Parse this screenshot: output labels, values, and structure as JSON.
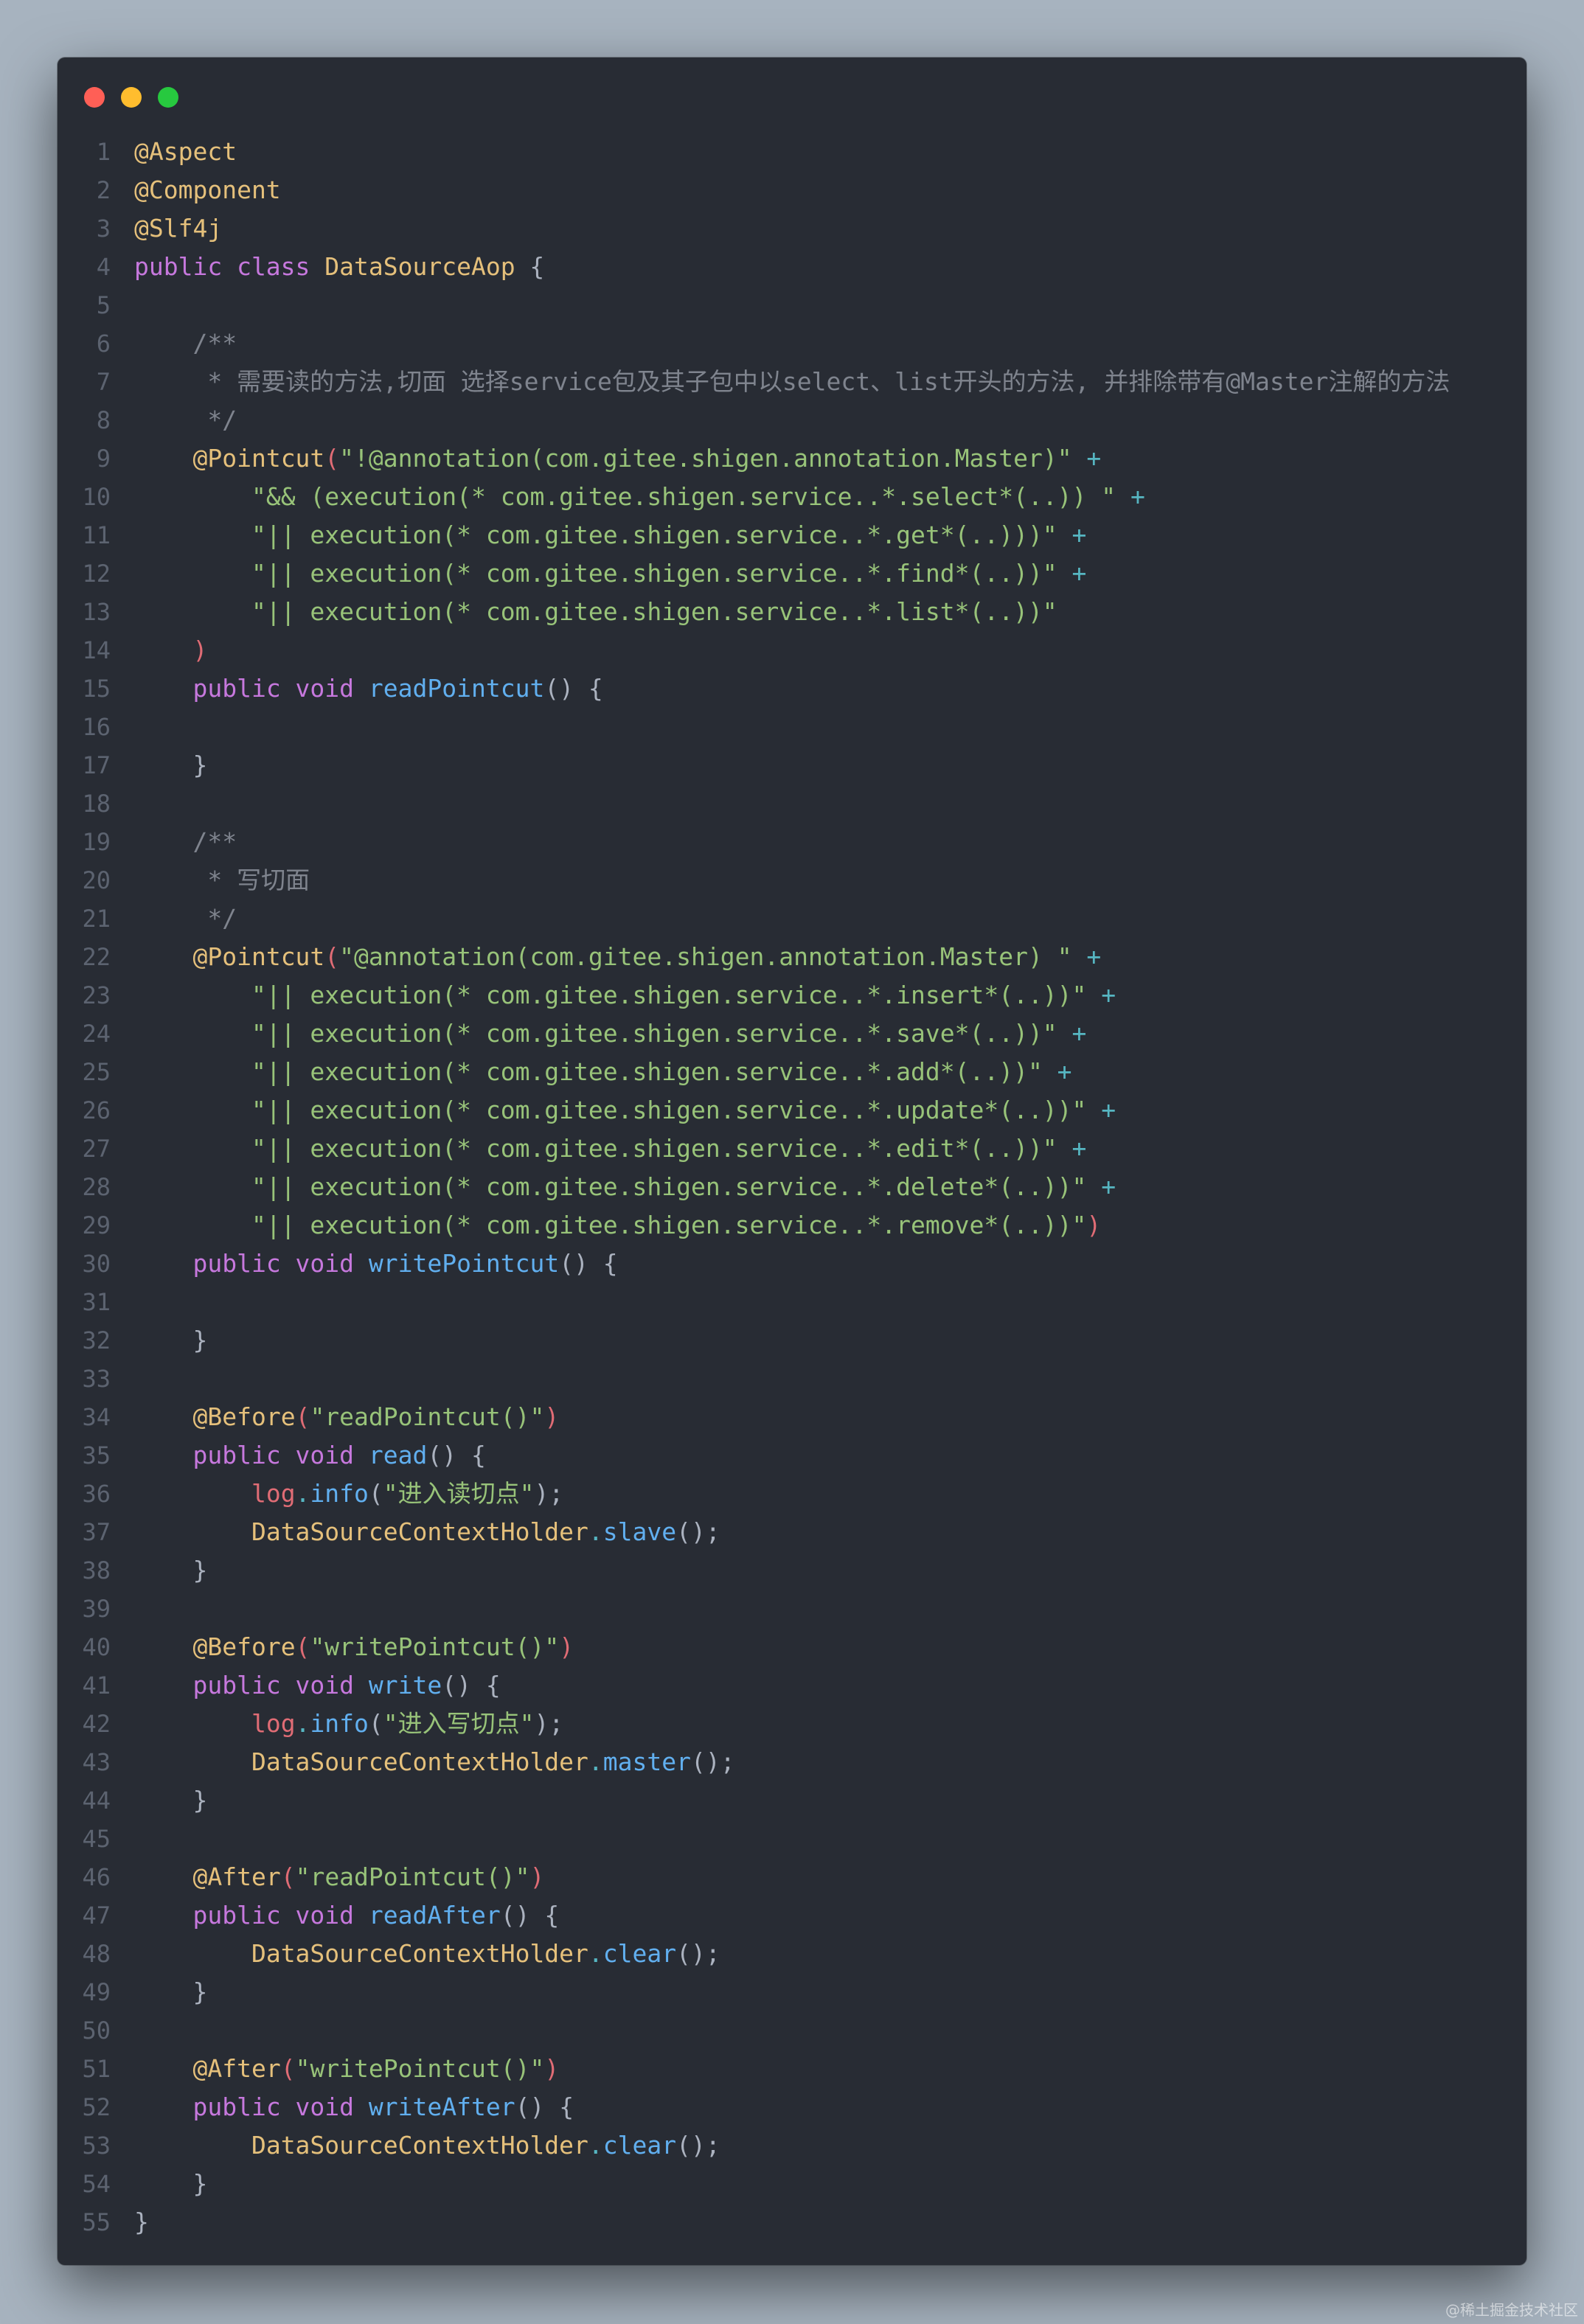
{
  "window": {
    "traffic_lights": [
      {
        "name": "close",
        "color": "#ff5f56"
      },
      {
        "name": "minimize",
        "color": "#ffbd2e"
      },
      {
        "name": "maximize",
        "color": "#27c93f"
      }
    ]
  },
  "theme": {
    "background": "#282c34",
    "page_background": "#a7b3bf",
    "line_number": "#5c6370",
    "keyword": "#c678dd",
    "annotation": "#e5c07b",
    "class_name": "#e5c07b",
    "function": "#61afef",
    "string": "#98c379",
    "operator": "#56b6c2",
    "comment": "#7f848e",
    "variable": "#e06c75"
  },
  "code_lines": [
    [
      [
        "ann",
        "@Aspect"
      ]
    ],
    [
      [
        "ann",
        "@Component"
      ]
    ],
    [
      [
        "ann",
        "@Slf4j"
      ]
    ],
    [
      [
        "kw",
        "public class "
      ],
      [
        "cls",
        "DataSourceAop"
      ],
      [
        "pun",
        " {"
      ]
    ],
    [],
    [
      [
        "com",
        "    /**"
      ]
    ],
    [
      [
        "com",
        "     * 需要读的方法,切面 选择service包及其子包中以select、list开头的方法, 并排除带有@Master注解的方法"
      ]
    ],
    [
      [
        "com",
        "     */"
      ]
    ],
    [
      [
        "txt",
        "    "
      ],
      [
        "ann",
        "@Pointcut"
      ],
      [
        "prn",
        "("
      ],
      [
        "str",
        "\"!@annotation(com.gitee.shigen.annotation.Master)\""
      ],
      [
        "op",
        " +"
      ]
    ],
    [
      [
        "txt",
        "        "
      ],
      [
        "str",
        "\"&& (execution(* com.gitee.shigen.service..*.select*(..)) \""
      ],
      [
        "op",
        " +"
      ]
    ],
    [
      [
        "txt",
        "        "
      ],
      [
        "str",
        "\"|| execution(* com.gitee.shigen.service..*.get*(..)))\""
      ],
      [
        "op",
        " +"
      ]
    ],
    [
      [
        "txt",
        "        "
      ],
      [
        "str",
        "\"|| execution(* com.gitee.shigen.service..*.find*(..))\""
      ],
      [
        "op",
        " +"
      ]
    ],
    [
      [
        "txt",
        "        "
      ],
      [
        "str",
        "\"|| execution(* com.gitee.shigen.service..*.list*(..))\""
      ]
    ],
    [
      [
        "txt",
        "    "
      ],
      [
        "prn",
        ")"
      ]
    ],
    [
      [
        "txt",
        "    "
      ],
      [
        "kw",
        "public void "
      ],
      [
        "fn",
        "readPointcut"
      ],
      [
        "pun",
        "() {"
      ]
    ],
    [],
    [
      [
        "pun",
        "    }"
      ]
    ],
    [],
    [
      [
        "com",
        "    /**"
      ]
    ],
    [
      [
        "com",
        "     * 写切面"
      ]
    ],
    [
      [
        "com",
        "     */"
      ]
    ],
    [
      [
        "txt",
        "    "
      ],
      [
        "ann",
        "@Pointcut"
      ],
      [
        "prn",
        "("
      ],
      [
        "str",
        "\"@annotation(com.gitee.shigen.annotation.Master) \""
      ],
      [
        "op",
        " +"
      ]
    ],
    [
      [
        "txt",
        "        "
      ],
      [
        "str",
        "\"|| execution(* com.gitee.shigen.service..*.insert*(..))\""
      ],
      [
        "op",
        " +"
      ]
    ],
    [
      [
        "txt",
        "        "
      ],
      [
        "str",
        "\"|| execution(* com.gitee.shigen.service..*.save*(..))\""
      ],
      [
        "op",
        " +"
      ]
    ],
    [
      [
        "txt",
        "        "
      ],
      [
        "str",
        "\"|| execution(* com.gitee.shigen.service..*.add*(..))\""
      ],
      [
        "op",
        " +"
      ]
    ],
    [
      [
        "txt",
        "        "
      ],
      [
        "str",
        "\"|| execution(* com.gitee.shigen.service..*.update*(..))\""
      ],
      [
        "op",
        " +"
      ]
    ],
    [
      [
        "txt",
        "        "
      ],
      [
        "str",
        "\"|| execution(* com.gitee.shigen.service..*.edit*(..))\""
      ],
      [
        "op",
        " +"
      ]
    ],
    [
      [
        "txt",
        "        "
      ],
      [
        "str",
        "\"|| execution(* com.gitee.shigen.service..*.delete*(..))\""
      ],
      [
        "op",
        " +"
      ]
    ],
    [
      [
        "txt",
        "        "
      ],
      [
        "str",
        "\"|| execution(* com.gitee.shigen.service..*.remove*(..))\""
      ],
      [
        "prn",
        ")"
      ]
    ],
    [
      [
        "txt",
        "    "
      ],
      [
        "kw",
        "public void "
      ],
      [
        "fn",
        "writePointcut"
      ],
      [
        "pun",
        "() {"
      ]
    ],
    [],
    [
      [
        "pun",
        "    }"
      ]
    ],
    [],
    [
      [
        "txt",
        "    "
      ],
      [
        "ann",
        "@Before"
      ],
      [
        "prn",
        "("
      ],
      [
        "str",
        "\"readPointcut()\""
      ],
      [
        "prn",
        ")"
      ]
    ],
    [
      [
        "txt",
        "    "
      ],
      [
        "kw",
        "public void "
      ],
      [
        "fn",
        "read"
      ],
      [
        "pun",
        "() {"
      ]
    ],
    [
      [
        "txt",
        "        "
      ],
      [
        "var",
        "log"
      ],
      [
        "op",
        "."
      ],
      [
        "fn",
        "info"
      ],
      [
        "pun",
        "("
      ],
      [
        "str",
        "\"进入读切点\""
      ],
      [
        "pun",
        ");"
      ]
    ],
    [
      [
        "txt",
        "        "
      ],
      [
        "cls",
        "DataSourceContextHolder"
      ],
      [
        "op",
        "."
      ],
      [
        "fn",
        "slave"
      ],
      [
        "pun",
        "();"
      ]
    ],
    [
      [
        "pun",
        "    }"
      ]
    ],
    [],
    [
      [
        "txt",
        "    "
      ],
      [
        "ann",
        "@Before"
      ],
      [
        "prn",
        "("
      ],
      [
        "str",
        "\"writePointcut()\""
      ],
      [
        "prn",
        ")"
      ]
    ],
    [
      [
        "txt",
        "    "
      ],
      [
        "kw",
        "public void "
      ],
      [
        "fn",
        "write"
      ],
      [
        "pun",
        "() {"
      ]
    ],
    [
      [
        "txt",
        "        "
      ],
      [
        "var",
        "log"
      ],
      [
        "op",
        "."
      ],
      [
        "fn",
        "info"
      ],
      [
        "pun",
        "("
      ],
      [
        "str",
        "\"进入写切点\""
      ],
      [
        "pun",
        ");"
      ]
    ],
    [
      [
        "txt",
        "        "
      ],
      [
        "cls",
        "DataSourceContextHolder"
      ],
      [
        "op",
        "."
      ],
      [
        "fn",
        "master"
      ],
      [
        "pun",
        "();"
      ]
    ],
    [
      [
        "pun",
        "    }"
      ]
    ],
    [],
    [
      [
        "txt",
        "    "
      ],
      [
        "ann",
        "@After"
      ],
      [
        "prn",
        "("
      ],
      [
        "str",
        "\"readPointcut()\""
      ],
      [
        "prn",
        ")"
      ]
    ],
    [
      [
        "txt",
        "    "
      ],
      [
        "kw",
        "public void "
      ],
      [
        "fn",
        "readAfter"
      ],
      [
        "pun",
        "() {"
      ]
    ],
    [
      [
        "txt",
        "        "
      ],
      [
        "cls",
        "DataSourceContextHolder"
      ],
      [
        "op",
        "."
      ],
      [
        "fn",
        "clear"
      ],
      [
        "pun",
        "();"
      ]
    ],
    [
      [
        "pun",
        "    }"
      ]
    ],
    [],
    [
      [
        "txt",
        "    "
      ],
      [
        "ann",
        "@After"
      ],
      [
        "prn",
        "("
      ],
      [
        "str",
        "\"writePointcut()\""
      ],
      [
        "prn",
        ")"
      ]
    ],
    [
      [
        "txt",
        "    "
      ],
      [
        "kw",
        "public void "
      ],
      [
        "fn",
        "writeAfter"
      ],
      [
        "pun",
        "() {"
      ]
    ],
    [
      [
        "txt",
        "        "
      ],
      [
        "cls",
        "DataSourceContextHolder"
      ],
      [
        "op",
        "."
      ],
      [
        "fn",
        "clear"
      ],
      [
        "pun",
        "();"
      ]
    ],
    [
      [
        "pun",
        "    }"
      ]
    ],
    [
      [
        "pun",
        "}"
      ]
    ]
  ],
  "watermark": "@稀土掘金技术社区"
}
